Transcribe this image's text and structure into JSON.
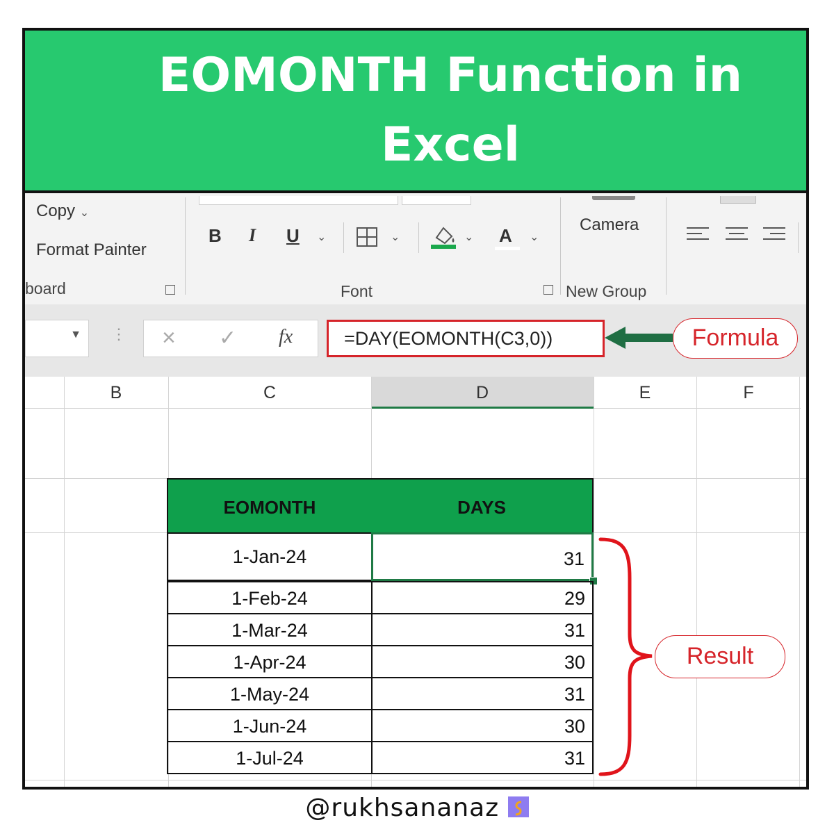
{
  "banner": {
    "title": "EOMONTH Function in Excel"
  },
  "ribbon": {
    "copy_label": "Copy",
    "format_painter_label": "Format Painter",
    "clipboard_group": "board",
    "font_group": "Font",
    "bold": "B",
    "italic": "I",
    "underline": "U",
    "font_color": "A",
    "camera_label": "Camera",
    "new_group": "New Group"
  },
  "formula_bar": {
    "cancel": "×",
    "enter": "✓",
    "fx": "fx",
    "formula": "=DAY(EOMONTH(C3,0))"
  },
  "columns": [
    "B",
    "C",
    "D",
    "E",
    "F"
  ],
  "table": {
    "headers": [
      "EOMONTH",
      "DAYS"
    ],
    "rows": [
      [
        "1-Jan-24",
        "31"
      ],
      [
        "1-Feb-24",
        "29"
      ],
      [
        "1-Mar-24",
        "31"
      ],
      [
        "1-Apr-24",
        "30"
      ],
      [
        "1-May-24",
        "31"
      ],
      [
        "1-Jun-24",
        "30"
      ],
      [
        "1-Jul-24",
        "31"
      ]
    ]
  },
  "annotations": {
    "formula": "Formula",
    "result": "Result"
  },
  "footer": {
    "handle": "@rukhsananaz"
  },
  "colors": {
    "banner": "#27c96f",
    "header": "#0fa04c",
    "accent_red": "#d6242a",
    "arrow": "#1f6e43"
  }
}
